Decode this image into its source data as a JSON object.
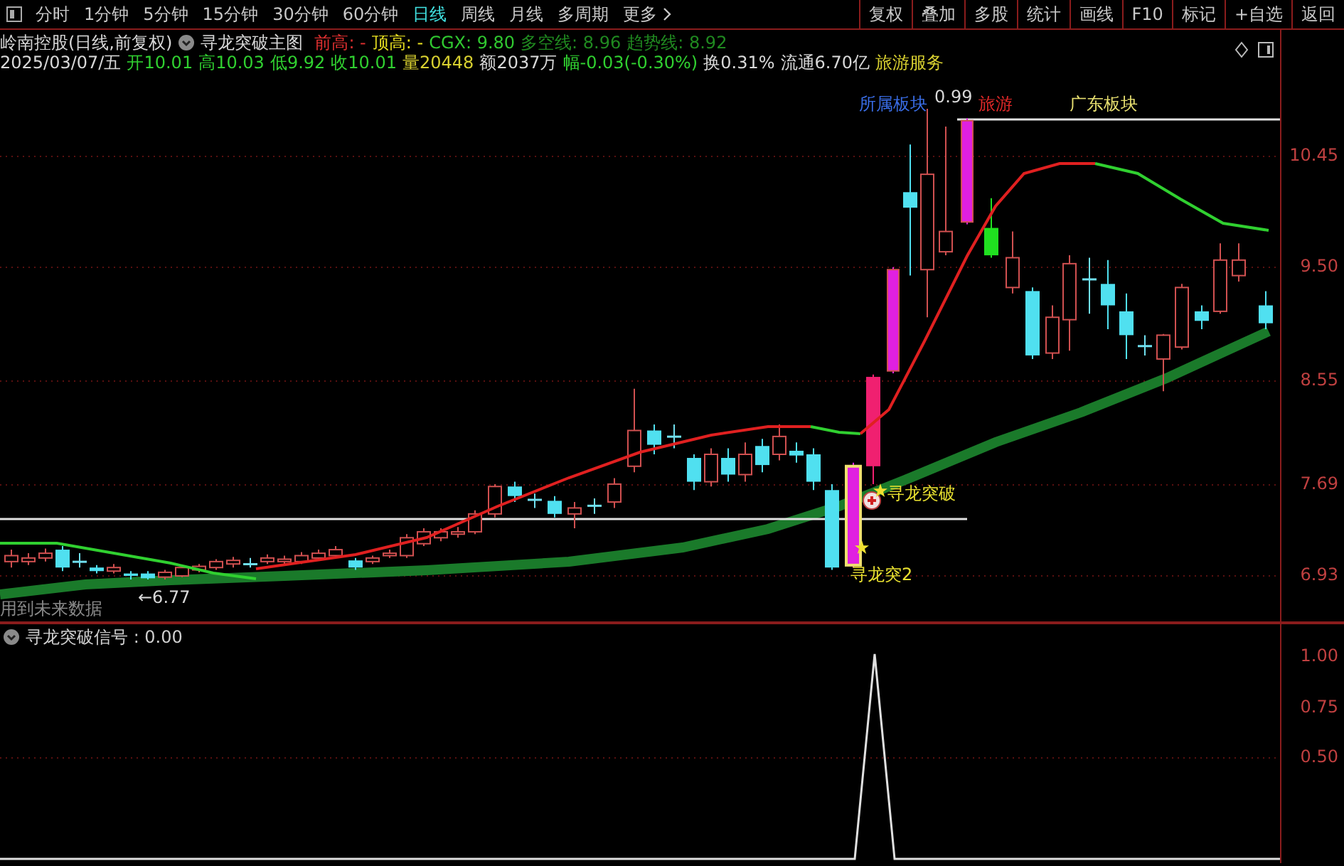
{
  "toolbar": {
    "tabs": [
      {
        "label": "分时",
        "selected": false
      },
      {
        "label": "1分钟",
        "selected": false
      },
      {
        "label": "5分钟",
        "selected": false
      },
      {
        "label": "15分钟",
        "selected": false
      },
      {
        "label": "30分钟",
        "selected": false
      },
      {
        "label": "60分钟",
        "selected": false
      },
      {
        "label": "日线",
        "selected": true
      },
      {
        "label": "周线",
        "selected": false
      },
      {
        "label": "月线",
        "selected": false
      },
      {
        "label": "多周期",
        "selected": false
      }
    ],
    "more": "更多",
    "buttons": [
      "复权",
      "叠加",
      "多股",
      "统计",
      "画线",
      "F10",
      "标记",
      "+自选",
      "返回"
    ]
  },
  "info": {
    "stock": "岭南控股(日线,前复权)",
    "indicator": "寻龙突破主图",
    "values": [
      {
        "text": "前高: -",
        "color": "#e03030"
      },
      {
        "text": "顶高: -",
        "color": "#e8e020"
      },
      {
        "text": "CGX: 9.80",
        "color": "#30c830"
      },
      {
        "text": "多空线: 8.96",
        "color": "#208a20"
      },
      {
        "text": "趋势线: 8.92",
        "color": "#208a20"
      }
    ]
  },
  "quote": [
    {
      "text": "2025/03/07/五",
      "color": "#d8d8d8"
    },
    {
      "text": "开10.01",
      "color": "#30d030"
    },
    {
      "text": "高10.03",
      "color": "#30d030"
    },
    {
      "text": "低9.92",
      "color": "#30d030"
    },
    {
      "text": "收10.01",
      "color": "#30d030"
    },
    {
      "text": "量20448",
      "color": "#d8d030"
    },
    {
      "text": "额2037万",
      "color": "#d8d8d8"
    },
    {
      "text": "幅-0.03(-0.30%)",
      "color": "#30d030"
    },
    {
      "text": "换0.31%",
      "color": "#d8d8d8"
    },
    {
      "text": "流通6.70亿",
      "color": "#d8d8d8"
    },
    {
      "text": "旅游服务",
      "color": "#d8d030"
    }
  ],
  "main_chart": {
    "price_axis": [
      "10.45",
      "9.50",
      "8.55",
      "7.69",
      "6.93"
    ],
    "labels": [
      {
        "text": "所属板块",
        "color": "#3a6ee8"
      },
      {
        "text": "0.99",
        "color": "#d8d8d8"
      },
      {
        "text": "旅游",
        "color": "#e02828"
      },
      {
        "text": "广东板块",
        "color": "#e8e070"
      },
      {
        "text": "寻龙突破",
        "color": "#e8e030"
      },
      {
        "text": "寻龙突2",
        "color": "#e8e030"
      },
      {
        "text": "←6.77",
        "color": "#d8d8d8"
      },
      {
        "text": "用到未来数据",
        "color": "#8a8a8a"
      }
    ]
  },
  "sub_chart": {
    "title": "寻龙突破信号 : 0.00",
    "axis": [
      "1.00",
      "0.75",
      "0.50"
    ]
  }
}
